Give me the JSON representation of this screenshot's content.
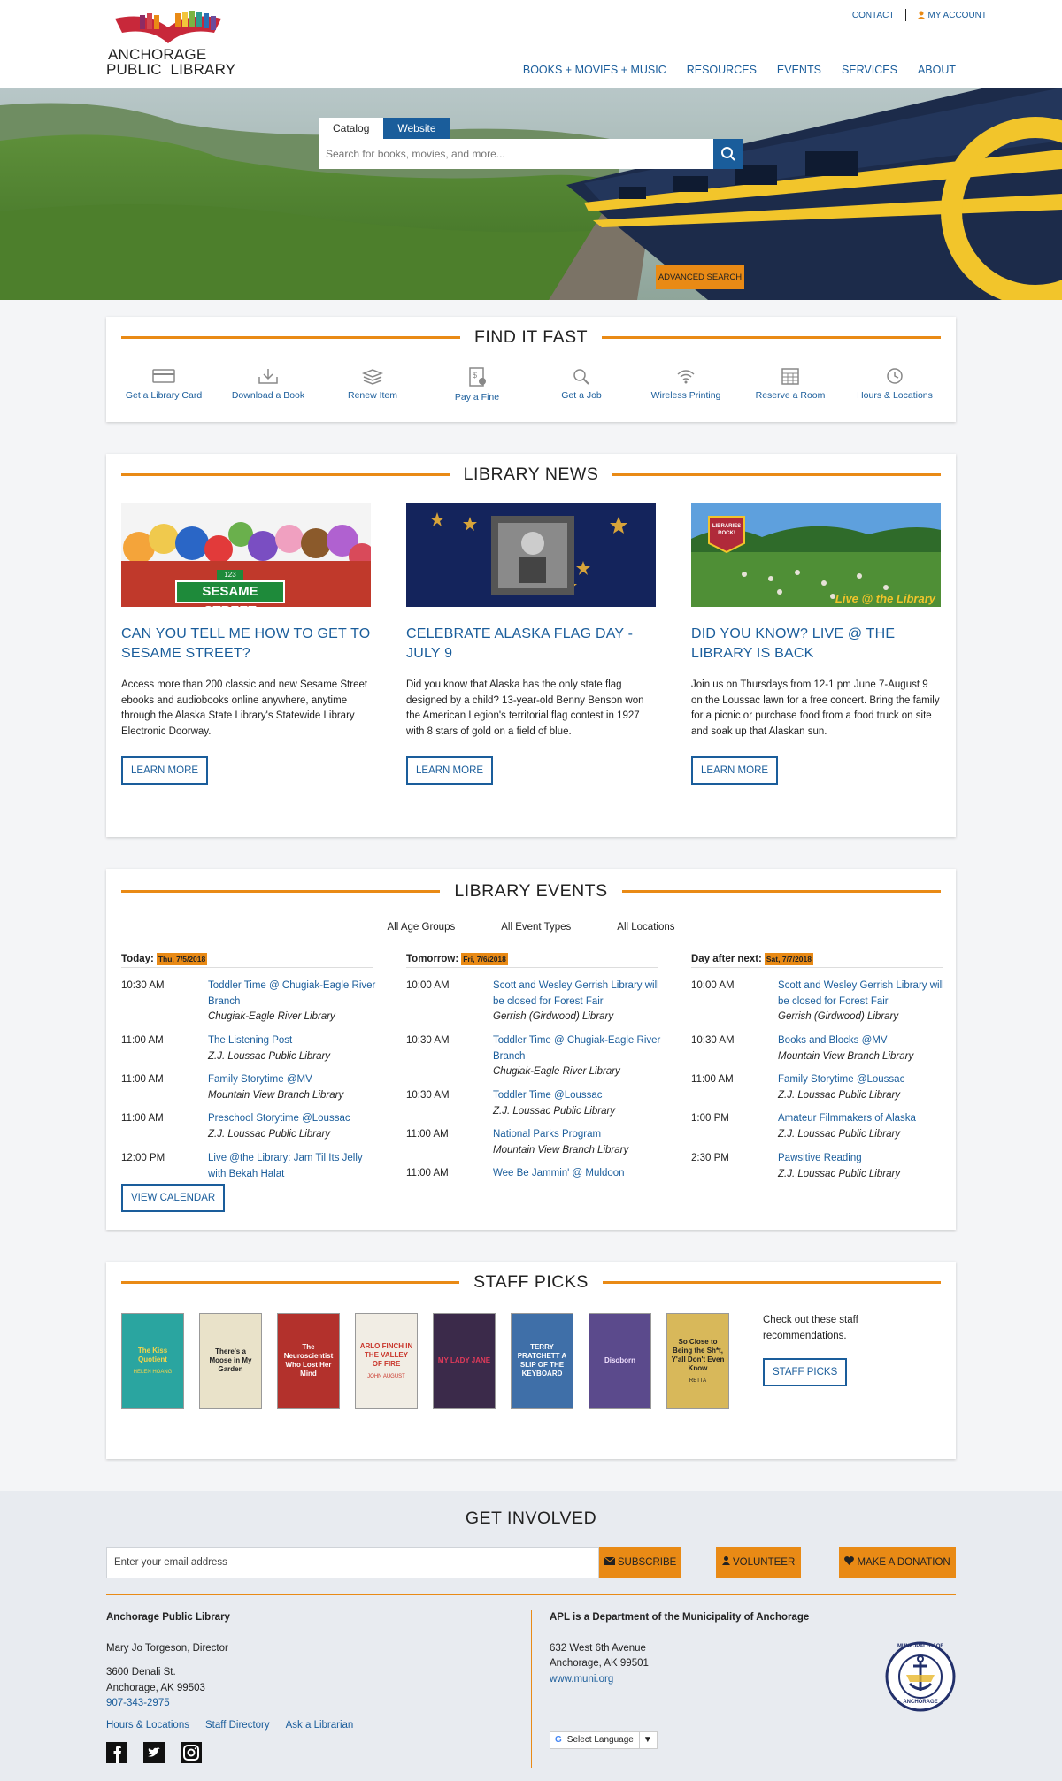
{
  "header": {
    "contact": "CONTACT",
    "my_account": "MY ACCOUNT",
    "logo_line1": "ANCHORAGE",
    "logo_line2": "PUBLIC  LIBRARY",
    "nav": [
      "BOOKS + MOVIES + MUSIC",
      "RESOURCES",
      "EVENTS",
      "SERVICES",
      "ABOUT"
    ]
  },
  "search": {
    "tab_catalog": "Catalog",
    "tab_website": "Website",
    "placeholder": "Search for books, movies, and more...",
    "advanced": "ADVANCED SEARCH"
  },
  "find_it_fast": {
    "title": "FIND IT FAST",
    "items": [
      "Get a Library Card",
      "Download a Book",
      "Renew Item",
      "Pay a Fine",
      "Get a Job",
      "Wireless Printing",
      "Reserve a Room",
      "Hours & Locations"
    ]
  },
  "news": {
    "title": "LIBRARY NEWS",
    "items": [
      {
        "heading": "CAN YOU TELL ME HOW TO GET TO SESAME STREET?",
        "body": "Access more than 200 classic and new Sesame Street ebooks and audiobooks online anywhere, anytime through the Alaska State Library's Statewide Library Electronic Doorway.",
        "button": "LEARN MORE",
        "image_text": "SESAME STREET",
        "image_sub": "123"
      },
      {
        "heading": "CELEBRATE ALASKA FLAG DAY - JULY 9",
        "body": "Did you know that Alaska has the only state flag designed by a child? 13-year-old Benny Benson won the American Legion's territorial flag contest in 1927 with 8 stars of gold on a field of blue.",
        "button": "LEARN MORE"
      },
      {
        "heading": "DID YOU KNOW? LIVE @ THE LIBRARY IS BACK",
        "body": "Join us on Thursdays from 12-1 pm June 7-August 9 on the Loussac lawn for a free concert. Bring the family for a picnic or purchase food from a food truck on site and soak up that Alaskan sun.",
        "button": "LEARN MORE",
        "image_text": "Live @ the Library",
        "image_badge": "LIBRARIES ROCK!"
      }
    ]
  },
  "events": {
    "title": "LIBRARY EVENTS",
    "filters": [
      "All Age Groups",
      "All Event Types",
      "All Locations"
    ],
    "columns": [
      {
        "label": "Today:",
        "date": "Thu, 7/5/2018",
        "items": [
          {
            "time": "10:30 AM",
            "name": "Toddler Time @ Chugiak-Eagle River Branch",
            "loc": "Chugiak-Eagle River Library"
          },
          {
            "time": "11:00 AM",
            "name": "The Listening Post",
            "loc": "Z.J. Loussac Public Library"
          },
          {
            "time": "11:00 AM",
            "name": "Family Storytime @MV",
            "loc": "Mountain View Branch Library"
          },
          {
            "time": "11:00 AM",
            "name": "Preschool Storytime @Loussac",
            "loc": "Z.J. Loussac Public Library"
          },
          {
            "time": "12:00 PM",
            "name": "Live @the Library: Jam Til Its Jelly with Bekah Halat",
            "loc": ""
          }
        ]
      },
      {
        "label": "Tomorrow:",
        "date": "Fri, 7/6/2018",
        "items": [
          {
            "time": "10:00 AM",
            "name": "Scott and Wesley Gerrish Library will be closed for Forest Fair",
            "loc": "Gerrish (Girdwood) Library"
          },
          {
            "time": "10:30 AM",
            "name": "Toddler Time @ Chugiak-Eagle River Branch",
            "loc": "Chugiak-Eagle River Library"
          },
          {
            "time": "10:30 AM",
            "name": "Toddler Time @Loussac",
            "loc": "Z.J. Loussac Public Library"
          },
          {
            "time": "11:00 AM",
            "name": "National Parks Program",
            "loc": "Mountain View Branch Library"
          },
          {
            "time": "11:00 AM",
            "name": "Wee Be Jammin' @ Muldoon",
            "loc": ""
          }
        ]
      },
      {
        "label": "Day after next:",
        "date": "Sat, 7/7/2018",
        "items": [
          {
            "time": "10:00 AM",
            "name": "Scott and Wesley Gerrish Library will be closed for Forest Fair",
            "loc": "Gerrish (Girdwood) Library"
          },
          {
            "time": "10:30 AM",
            "name": "Books and Blocks @MV",
            "loc": "Mountain View Branch Library"
          },
          {
            "time": "11:00 AM",
            "name": "Family Storytime @Loussac",
            "loc": "Z.J. Loussac Public Library"
          },
          {
            "time": "1:00 PM",
            "name": "Amateur Filmmakers of Alaska",
            "loc": "Z.J. Loussac Public Library"
          },
          {
            "time": "2:30 PM",
            "name": "Pawsitive Reading",
            "loc": "Z.J. Loussac Public Library"
          }
        ]
      }
    ],
    "button": "VIEW CALENDAR"
  },
  "staff_picks": {
    "title": "STAFF PICKS",
    "text": "Check out these staff recommendations.",
    "button": "STAFF PICKS",
    "books": [
      {
        "title": "The Kiss Quotient",
        "author": "HELEN HOANG",
        "bg": "#2aa5a0",
        "fg": "#f5d44a"
      },
      {
        "title": "There's a Moose in My Garden",
        "author": "",
        "bg": "#e9e2c9",
        "fg": "#222"
      },
      {
        "title": "The Neuroscientist Who Lost Her Mind",
        "author": "",
        "bg": "#b3312c",
        "fg": "#fff"
      },
      {
        "title": "ARLO FINCH IN THE VALLEY OF FIRE",
        "author": "JOHN AUGUST",
        "bg": "#f1ede4",
        "fg": "#c9362b"
      },
      {
        "title": "MY LADY JANE",
        "author": "",
        "bg": "#3b2a4a",
        "fg": "#e03a5a"
      },
      {
        "title": "TERRY PRATCHETT A SLIP OF THE KEYBOARD",
        "author": "",
        "bg": "#3f6fa8",
        "fg": "#fff"
      },
      {
        "title": "Disoborn",
        "author": "",
        "bg": "#5b4a8c",
        "fg": "#f0e0ff"
      },
      {
        "title": "So Close to Being the Sh*t, Y'all Don't Even Know",
        "author": "RETTA",
        "bg": "#d8b85a",
        "fg": "#222"
      }
    ]
  },
  "footer": {
    "title": "GET INVOLVED",
    "email_placeholder": "Enter your email address",
    "subscribe": "SUBSCRIBE",
    "volunteer": "VOLUNTEER",
    "donate": "MAKE A DONATION",
    "left": {
      "name": "Anchorage Public Library",
      "director": "Mary Jo Torgeson, Director",
      "addr1": "3600 Denali St.",
      "addr2": "Anchorage, AK 99503",
      "phone": "907-343-2975",
      "links": [
        "Hours & Locations",
        "Staff Directory",
        "Ask a Librarian"
      ]
    },
    "right": {
      "heading": "APL is a Department of the Municipality of Anchorage",
      "addr1": "632 West 6th Avenue",
      "addr2": "Anchorage, AK 99501",
      "link": "www.muni.org",
      "language": "Select Language",
      "seal_top": "MUNICIPALITY OF",
      "seal_bottom": "ANCHORAGE"
    }
  }
}
